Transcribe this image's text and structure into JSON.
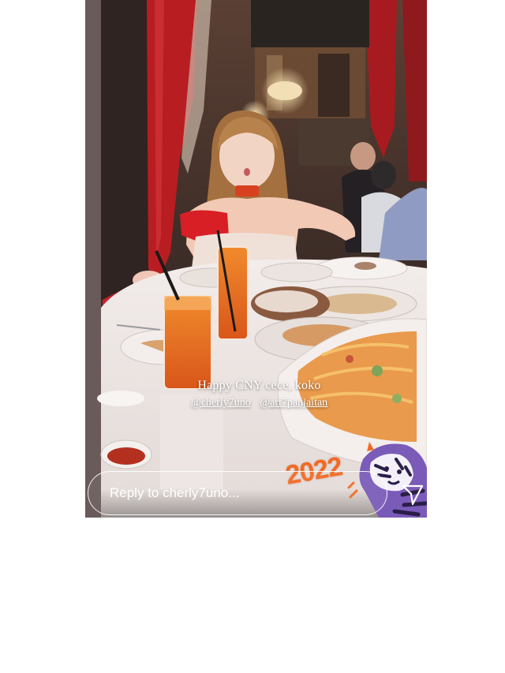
{
  "story": {
    "caption": "Happy CNY cece, koko",
    "mentions": [
      "@cherly7uno",
      "@art7panjaitan"
    ]
  },
  "stickers": {
    "year_text": "2022",
    "tiger_icon": "tiger-sticker-icon"
  },
  "reply": {
    "placeholder": "Reply to cherly7uno..."
  },
  "icons": {
    "send": "paper-plane-icon"
  },
  "colors": {
    "page_background": "#ffffff",
    "sticker_orange": "#f26a23",
    "tiger_purple": "#7a5bb8",
    "drink_amber": "#e8701d",
    "dress_red": "#d81f26"
  }
}
